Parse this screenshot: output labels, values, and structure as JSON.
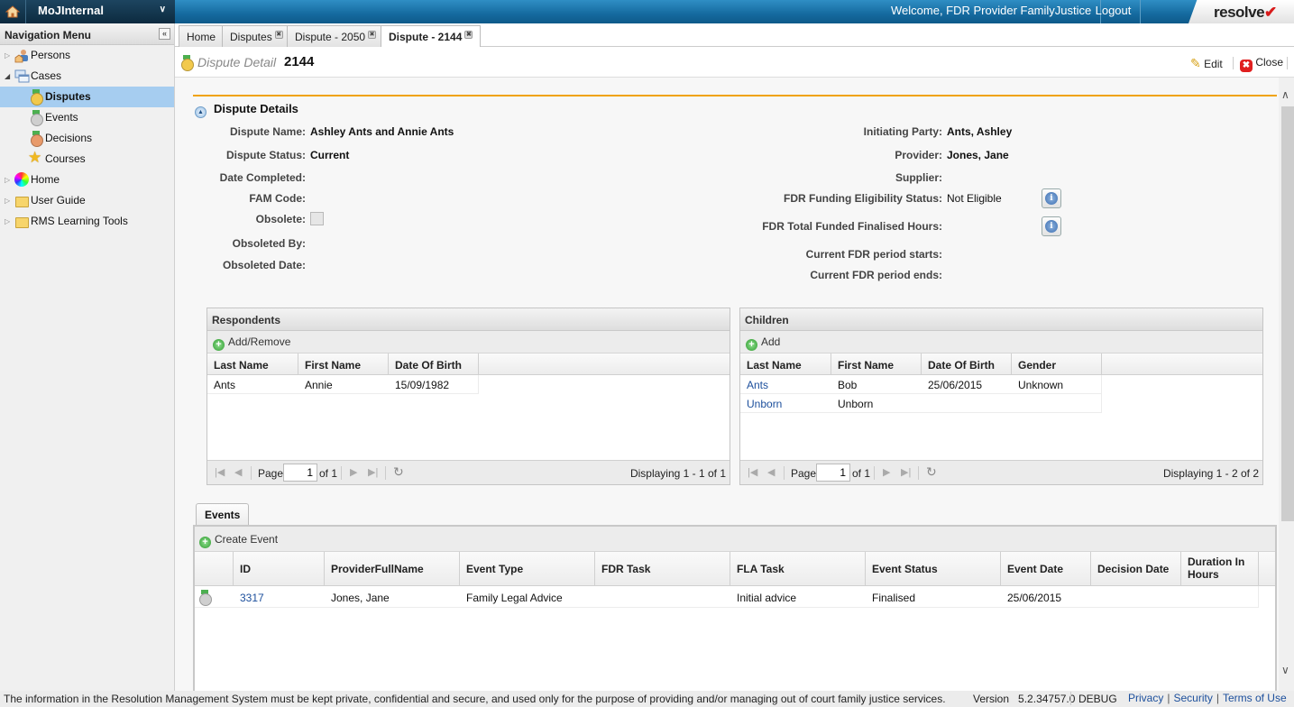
{
  "topbar": {
    "app_name": "MoJInternal",
    "welcome": "Welcome, FDR Provider FamilyJustice",
    "logout": "Logout",
    "logo": "resolve"
  },
  "sidebar": {
    "title": "Navigation Menu",
    "items": [
      {
        "label": "Persons",
        "icon": "persons-icon",
        "expanded": false
      },
      {
        "label": "Cases",
        "icon": "cases-icon",
        "expanded": true
      },
      {
        "label": "Disputes",
        "icon": "gold-medal-icon",
        "selected": true
      },
      {
        "label": "Events",
        "icon": "silver-medal-icon"
      },
      {
        "label": "Decisions",
        "icon": "bronze-medal-icon"
      },
      {
        "label": "Courses",
        "icon": "star-icon"
      },
      {
        "label": "Home",
        "icon": "color-wheel-icon",
        "expanded": false
      },
      {
        "label": "User Guide",
        "icon": "folder-icon",
        "expanded": false
      },
      {
        "label": "RMS Learning Tools",
        "icon": "folder-icon",
        "expanded": false
      }
    ]
  },
  "tabs": [
    {
      "label": "Home",
      "closable": false
    },
    {
      "label": "Disputes",
      "closable": true
    },
    {
      "label": "Dispute - 2050",
      "closable": true
    },
    {
      "label": "Dispute - 2144",
      "closable": true,
      "active": true
    }
  ],
  "titlebar": {
    "type": "Dispute Detail",
    "id": "2144",
    "edit": "Edit",
    "close": "Close"
  },
  "details": {
    "section_title": "Dispute Details",
    "left": [
      {
        "label": "Dispute Name:",
        "value": "Ashley Ants and Annie Ants"
      },
      {
        "label": "Dispute Status:",
        "value": "Current"
      },
      {
        "label": "Date Completed:",
        "value": ""
      },
      {
        "label": "FAM Code:",
        "value": ""
      },
      {
        "label": "Obsolete:",
        "value": "",
        "checkbox": false
      },
      {
        "label": "Obsoleted By:",
        "value": ""
      },
      {
        "label": "Obsoleted Date:",
        "value": ""
      }
    ],
    "right": [
      {
        "label": "Initiating Party:",
        "value": "Ants, Ashley"
      },
      {
        "label": "Provider:",
        "value": "Jones, Jane"
      },
      {
        "label": "Supplier:",
        "value": ""
      },
      {
        "label": "FDR Funding Eligibility Status:",
        "value": "Not Eligible"
      },
      {
        "label": "FDR Total Funded Finalised Hours:",
        "value": ""
      },
      {
        "label": "Current FDR period starts:",
        "value": ""
      },
      {
        "label": "Current FDR period ends:",
        "value": ""
      }
    ]
  },
  "respondents": {
    "title": "Respondents",
    "action": "Add/Remove",
    "columns": [
      "Last Name",
      "First Name",
      "Date Of Birth"
    ],
    "rows": [
      [
        "Ants",
        "Annie",
        "15/09/1982"
      ]
    ],
    "pager": {
      "page_label": "Page",
      "page": "1",
      "of": "of 1",
      "display": "Displaying 1 - 1 of 1"
    }
  },
  "children": {
    "title": "Children",
    "action": "Add",
    "columns": [
      "Last Name",
      "First Name",
      "Date Of Birth",
      "Gender"
    ],
    "rows": [
      [
        "Ants",
        "Bob",
        "25/06/2015",
        "Unknown"
      ],
      [
        "Unborn",
        "Unborn",
        "",
        ""
      ]
    ],
    "pager": {
      "page_label": "Page",
      "page": "1",
      "of": "of 1",
      "display": "Displaying 1 - 2 of 2"
    }
  },
  "events": {
    "tab": "Events",
    "action": "Create Event",
    "columns": [
      "",
      "ID",
      "ProviderFullName",
      "Event Type",
      "FDR Task",
      "FLA Task",
      "Event Status",
      "Event Date",
      "Decision Date",
      "Duration In Hours"
    ],
    "rows": [
      [
        "silver-medal-icon",
        "3317",
        "Jones, Jane",
        "Family Legal Advice",
        "",
        "Initial advice",
        "Finalised",
        "25/06/2015",
        "",
        ""
      ]
    ]
  },
  "footer": {
    "message": "The information in the Resolution Management System must be kept private, confidential and secure, and used only for the purpose of providing and/or managing out of court family justice services.",
    "version_label": "Version",
    "version": "5.2.34757.0",
    "debug": "DEBUG",
    "links": [
      "Privacy",
      "Security",
      "Terms of Use"
    ]
  }
}
